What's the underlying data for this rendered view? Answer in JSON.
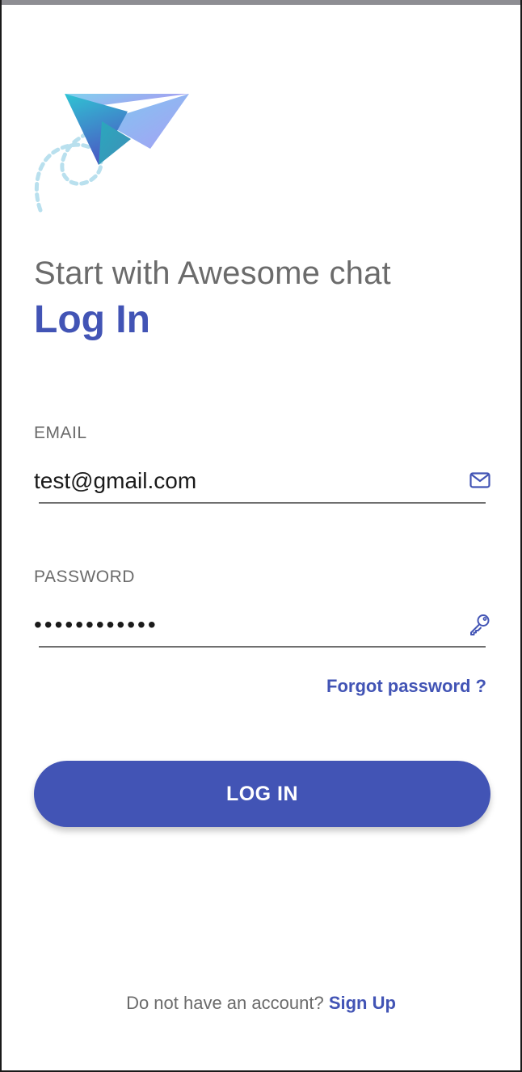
{
  "header": {
    "subtitle": "Start with Awesome chat",
    "title": "Log In"
  },
  "email": {
    "label": "EMAIL",
    "value": "test@gmail.com",
    "icon": "mail-icon"
  },
  "password": {
    "label": "PASSWORD",
    "value": "••••••••••••",
    "icon": "key-icon"
  },
  "forgot_password": "Forgot password ?",
  "login_button": "LOG IN",
  "footer": {
    "text": "Do not have an account?",
    "link": "Sign Up"
  },
  "logo": {
    "icon": "paper-plane-logo"
  },
  "colors": {
    "primary": "#4254b5",
    "text_muted": "#6b6b6b",
    "underline": "#6f6f6f",
    "plane_cyan": "#2ec4d6",
    "plane_purple": "#8ea2f0",
    "dashes": "#b9e0ee"
  }
}
